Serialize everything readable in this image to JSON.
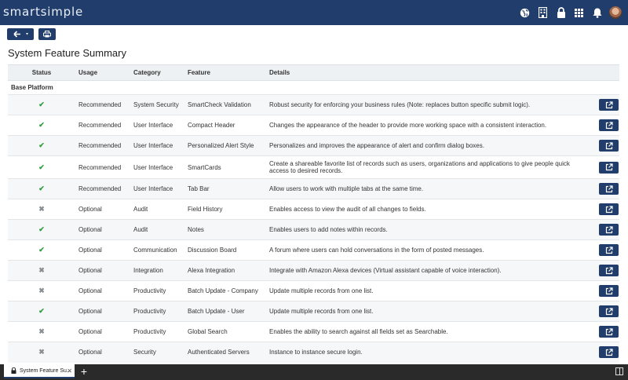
{
  "app": {
    "logo": "smartsimple"
  },
  "topbar": {
    "icons": [
      "globe-icon",
      "building-icon",
      "lock-icon",
      "grid-icon",
      "bell-icon",
      "avatar"
    ]
  },
  "toolbar": {
    "back_icon": "arrow-left-icon",
    "print_icon": "print-icon"
  },
  "page": {
    "title": "System Feature Summary"
  },
  "table": {
    "headers": {
      "status": "Status",
      "usage": "Usage",
      "category": "Category",
      "feature": "Feature",
      "details": "Details"
    },
    "section": "Base Platform",
    "rows": [
      {
        "status": "enabled",
        "status_glyph": "✔",
        "usage": "Recommended",
        "category": "System Security",
        "feature": "SmartCheck Validation",
        "details": "Robust security for enforcing your business rules (Note: replaces button specific submit logic)."
      },
      {
        "status": "enabled",
        "status_glyph": "✔",
        "usage": "Recommended",
        "category": "User Interface",
        "feature": "Compact Header",
        "details": "Changes the appearance of the header to provide more working space with a consistent interaction."
      },
      {
        "status": "enabled",
        "status_glyph": "✔",
        "usage": "Recommended",
        "category": "User Interface",
        "feature": "Personalized Alert Style",
        "details": "Personalizes and improves the appearance of alert and confirm dialog boxes."
      },
      {
        "status": "enabled",
        "status_glyph": "✔",
        "usage": "Recommended",
        "category": "User Interface",
        "feature": "SmartCards",
        "details": "Create a shareable favorite list of records such as users, organizations and applications to give people quick access to desired records."
      },
      {
        "status": "enabled",
        "status_glyph": "✔",
        "usage": "Recommended",
        "category": "User Interface",
        "feature": "Tab Bar",
        "details": "Allow users to work with multiple tabs at the same time."
      },
      {
        "status": "disabled",
        "status_glyph": "✖",
        "usage": "Optional",
        "category": "Audit",
        "feature": "Field History",
        "details": "Enables access to view the audit of all changes to fields."
      },
      {
        "status": "enabled",
        "status_glyph": "✔",
        "usage": "Optional",
        "category": "Audit",
        "feature": "Notes",
        "details": "Enables users to add notes within records."
      },
      {
        "status": "enabled",
        "status_glyph": "✔",
        "usage": "Optional",
        "category": "Communication",
        "feature": "Discussion Board",
        "details": "A forum where users can hold conversations in the form of posted messages."
      },
      {
        "status": "disabled",
        "status_glyph": "✖",
        "usage": "Optional",
        "category": "Integration",
        "feature": "Alexa Integration",
        "details": "Integrate with Amazon Alexa devices (Virtual assistant capable of voice interaction)."
      },
      {
        "status": "disabled",
        "status_glyph": "✖",
        "usage": "Optional",
        "category": "Productivity",
        "feature": "Batch Update - Company",
        "details": "Update multiple records from one list."
      },
      {
        "status": "enabled",
        "status_glyph": "✔",
        "usage": "Optional",
        "category": "Productivity",
        "feature": "Batch Update - User",
        "details": "Update multiple records from one list."
      },
      {
        "status": "disabled",
        "status_glyph": "✖",
        "usage": "Optional",
        "category": "Productivity",
        "feature": "Global Search",
        "details": "Enables the ability to search against all fields set as Searchable."
      },
      {
        "status": "disabled",
        "status_glyph": "✖",
        "usage": "Optional",
        "category": "Security",
        "feature": "Authenticated Servers",
        "details": "Instance to instance secure login."
      }
    ]
  },
  "bottombar": {
    "tab_label": "System Feature Su...",
    "tab_close": "✕",
    "add_tab": "+"
  },
  "colors": {
    "brand": "#213d6b",
    "enabled": "#2e9c3c",
    "disabled": "#8a8f94"
  }
}
